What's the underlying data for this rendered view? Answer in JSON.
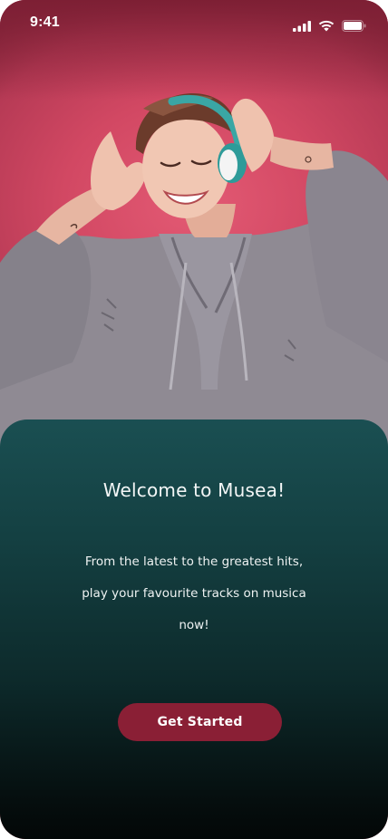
{
  "status_bar": {
    "time": "9:41",
    "icons": [
      "cellular-signal-icon",
      "wifi-icon",
      "battery-icon"
    ]
  },
  "hero": {
    "image": "woman-with-headphones-photo",
    "background_color": "#d24863"
  },
  "welcome": {
    "title": "Welcome to Musea!",
    "body_lines": [
      "From the latest to the greatest hits,",
      "play your favourite tracks on musica",
      "now!"
    ]
  },
  "cta": {
    "label": "Get Started",
    "color": "#8a1f35"
  },
  "colors": {
    "panel_top": "#1a4f52",
    "panel_bottom": "#030707",
    "accent": "#8a1f35"
  }
}
